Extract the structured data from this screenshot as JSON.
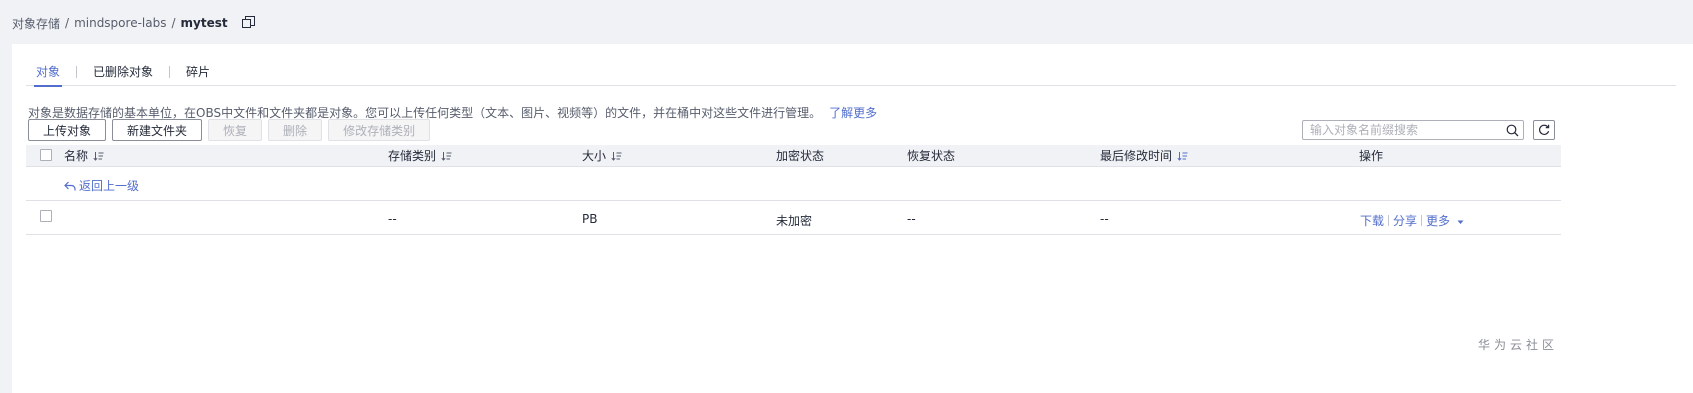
{
  "breadcrumb": {
    "root": "对象存储",
    "bucket": "mindspore-labs",
    "current": "mytest",
    "separator": "/"
  },
  "tabs": [
    {
      "label": "对象",
      "active": true
    },
    {
      "label": "已删除对象",
      "active": false
    },
    {
      "label": "碎片",
      "active": false
    }
  ],
  "description": {
    "text": "对象是数据存储的基本单位，在OBS中文件和文件夹都是对象。您可以上传任何类型（文本、图片、视频等）的文件，并在桶中对这些文件进行管理。",
    "link": "了解更多"
  },
  "toolbar": {
    "upload": "上传对象",
    "new_folder": "新建文件夹",
    "restore": "恢复",
    "delete": "删除",
    "change_class": "修改存储类别"
  },
  "search": {
    "placeholder": "输入对象名前缀搜索",
    "value": ""
  },
  "table": {
    "headers": {
      "name": "名称",
      "storage_class": "存储类别",
      "size": "大小",
      "encryption": "加密状态",
      "restore": "恢复状态",
      "modified": "最后修改时间",
      "actions": "操作"
    },
    "back": "返回上一级",
    "rows": [
      {
        "name": "",
        "storage_class": "--",
        "size": "PB",
        "encryption": "未加密",
        "restore": "--",
        "modified": "--",
        "actions": {
          "download": "下载",
          "share": "分享",
          "more": "更多"
        }
      }
    ]
  },
  "watermark": "华为云社区",
  "colors": {
    "accent": "#526ecc",
    "text": "#252b3a",
    "muted": "#575d6c",
    "background": "#f0f2f5"
  }
}
